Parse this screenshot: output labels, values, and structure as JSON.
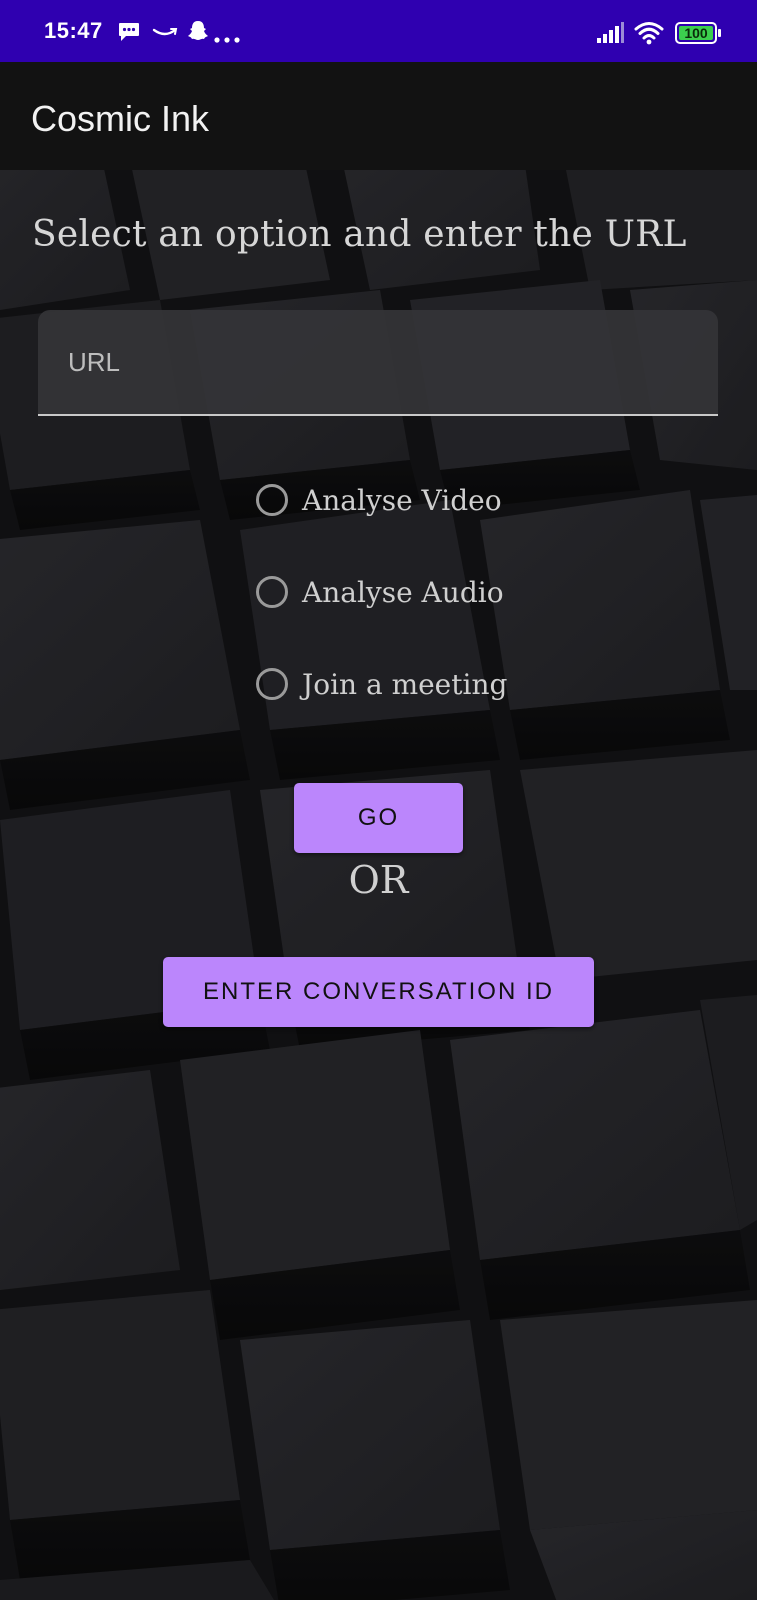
{
  "status_bar": {
    "time": "15:47",
    "battery": "100",
    "icons": [
      "message-icon",
      "amazon-icon",
      "snapchat-icon",
      "more-dots-icon",
      "signal-icon",
      "wifi-icon",
      "battery-icon"
    ]
  },
  "app_bar": {
    "title": "Cosmic Ink"
  },
  "main": {
    "headline": "Select an option and enter the URL",
    "url_field": {
      "placeholder": "URL",
      "value": ""
    },
    "options": [
      {
        "label": "Analyse Video",
        "selected": false
      },
      {
        "label": "Analyse Audio",
        "selected": false
      },
      {
        "label": "Join a meeting",
        "selected": false
      }
    ],
    "go_button": "GO",
    "or_text": "OR",
    "conversation_button": "ENTER CONVERSATION ID"
  },
  "colors": {
    "status_bar": "#2f00b0",
    "app_bar": "#121212",
    "accent": "#bb86fc",
    "battery_fill": "#3ccf4e"
  }
}
